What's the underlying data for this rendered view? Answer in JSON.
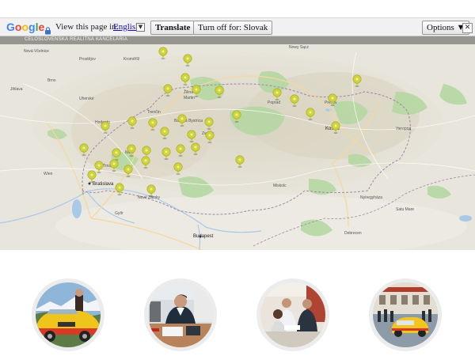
{
  "translate_bar": {
    "logo": "Google",
    "prompt": "View this page in:",
    "language": "English",
    "translate_button": "Translate",
    "turn_off_button": "Turn off for: Slovak",
    "options_button": "Options ▼",
    "close_glyph": "✕"
  },
  "map": {
    "header_text": "CELOSLOVENSKÁ REALITNÁ KANCELÁRIA",
    "marker_color": "#cfd33a",
    "major_cities": {
      "bratislava": "Bratislava",
      "kosice": "Košice",
      "budapest": "Budapest"
    },
    "cities": {
      "nitra": "Nitra",
      "trencin": "Trenčín",
      "zilina": "Žilina",
      "martin": "Martin",
      "bystrica": "Banská Bystrica",
      "zvolen": "Zvolen",
      "poprad": "Poprad",
      "presov": "Prešov",
      "trnava": "Trnava",
      "miskolc": "Miskolc",
      "debrecen": "Debrecen",
      "brno": "Brno",
      "wien": "Wien",
      "gyor": "Győr",
      "uzhhorod": "Ужгород",
      "nowy_sacz": "Nowy Sącz",
      "komarno": "Nové Zámky",
      "satu_mare": "Satu Mare",
      "nyiregyhaza": "Nyíregyháza"
    }
  },
  "photos": [
    {
      "label": "team-car"
    },
    {
      "label": "agent-desk"
    },
    {
      "label": "handshake"
    },
    {
      "label": "fleet-cars"
    }
  ]
}
